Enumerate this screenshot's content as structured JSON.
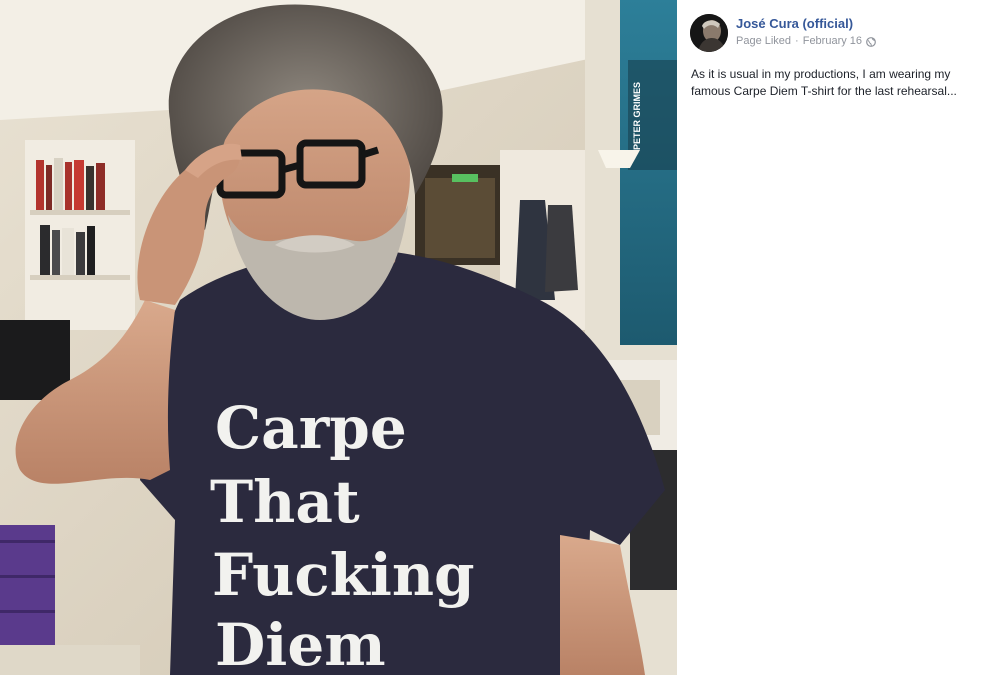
{
  "post": {
    "page_name": "José Cura (official)",
    "status": "Page Liked",
    "separator": "·",
    "date": "February 16",
    "privacy_icon": "globe-icon",
    "text_line_1": "As it is usual in my productions, I am wearing my",
    "text_line_2": "famous Carpe Diem T-shirt for the last rehearsal..."
  },
  "photo": {
    "shirt_line_1": "Carpe",
    "shirt_line_2": "That",
    "shirt_line_3": "Fucking",
    "shirt_line_4": "Diem",
    "poster_text": "PETER GRIMES"
  },
  "colors": {
    "link": "#365899",
    "meta": "#90949c",
    "body_text": "#1d2129",
    "shirt": "#2b2a3e"
  }
}
